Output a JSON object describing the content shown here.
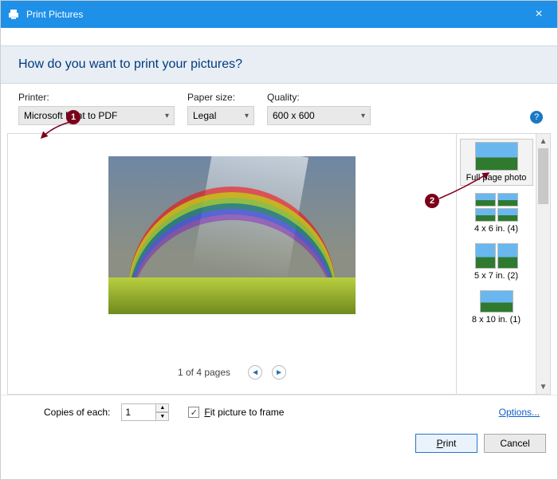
{
  "titlebar": {
    "title": "Print Pictures",
    "close_icon": "×"
  },
  "header": {
    "question": "How do you want to print your pictures?"
  },
  "fields": {
    "printer": {
      "label": "Printer:",
      "value": "Microsoft Print to PDF"
    },
    "paper_size": {
      "label": "Paper size:",
      "value": "Legal"
    },
    "quality": {
      "label": "Quality:",
      "value": "600 x 600"
    }
  },
  "help_icon": "?",
  "pager": {
    "label": "1 of 4 pages",
    "prev_icon": "◄",
    "next_icon": "►"
  },
  "layouts": {
    "items": [
      {
        "label": "Full page photo"
      },
      {
        "label": "4 x 6 in. (4)"
      },
      {
        "label": "5 x 7 in. (2)"
      },
      {
        "label": "8 x 10 in. (1)"
      }
    ],
    "scroll_up": "▲",
    "scroll_down": "▼"
  },
  "copies": {
    "label": "Copies of each:",
    "value": "1",
    "up": "▲",
    "down": "▼"
  },
  "fit": {
    "label": "Fit picture to frame",
    "checked": "✓"
  },
  "options_link": "Options...",
  "buttons": {
    "print": "Print",
    "cancel": "Cancel"
  },
  "callouts": {
    "one": "1",
    "two": "2"
  }
}
